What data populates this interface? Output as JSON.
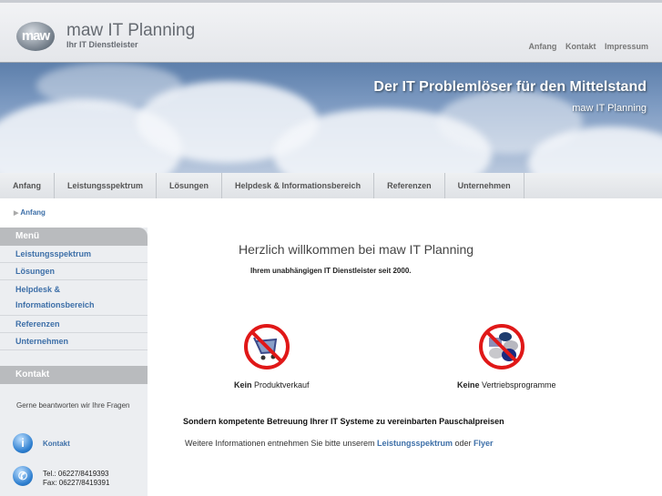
{
  "header": {
    "logo_text": "maw",
    "brand": "maw IT Planning",
    "tagline": "Ihr IT Dienstleister",
    "links": [
      "Anfang",
      "Kontakt",
      "Impressum"
    ]
  },
  "banner": {
    "headline": "Der IT Problemlöser für den Mittelstand",
    "subline": "maw IT Planning"
  },
  "nav": [
    "Anfang",
    "Leistungsspektrum",
    "Lösungen",
    "Helpdesk & Informationsbereich",
    "Referenzen",
    "Unternehmen"
  ],
  "breadcrumb": "Anfang",
  "sidebar": {
    "menu_title": "Menü",
    "items": [
      "Leistungsspektrum",
      "Lösungen",
      "Helpdesk & Informationsbereich",
      "Referenzen",
      "Unternehmen"
    ],
    "contact_title": "Kontakt",
    "contact_text": "Gerne beantworten wir Ihre Fragen",
    "contact_link": "Kontakt",
    "tel": "Tel.: 06227/8419393",
    "fax": "Fax: 06227/8419391"
  },
  "main": {
    "title": "Herzlich willkommen bei maw IT Planning",
    "subtitle": "Ihrem unabhängigen IT Dienstleister seit 2000.",
    "feature1_bold": "Kein",
    "feature1_text": " Produktverkauf",
    "feature2_bold": "Keine",
    "feature2_text": " Vertriebsprogramme",
    "statement": "Sondern kompetente Betreuung Ihrer IT Systeme zu vereinbarten Pauschalpreisen",
    "more_prefix": "Weitere Informationen entnehmen Sie bitte unserem ",
    "more_link1": "Leistungsspektrum",
    "more_mid": " oder ",
    "more_link2": "Flyer"
  }
}
